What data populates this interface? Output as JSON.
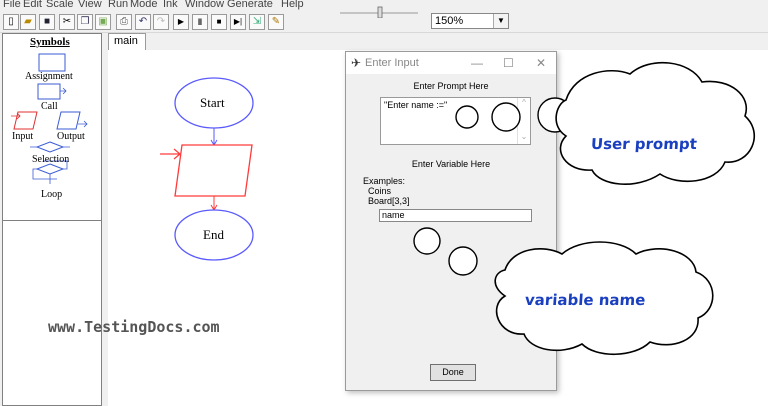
{
  "menubar": [
    "File",
    "Edit",
    "Scale",
    "View",
    "Run",
    "Mode",
    "Ink",
    "Window",
    "Generate",
    "Help"
  ],
  "toolbar": {
    "zoom_value": "150%",
    "buttons": [
      "new",
      "open",
      "save",
      "cut",
      "copy",
      "paste",
      "print",
      "undo",
      "redo",
      "run",
      "pause",
      "stop",
      "step",
      "step-into",
      "ink"
    ]
  },
  "symbols": {
    "header": "Symbols",
    "items": [
      "Assignment",
      "Call",
      "Input",
      "Output",
      "Selection",
      "Loop"
    ]
  },
  "tab": {
    "label": "main"
  },
  "flowchart": {
    "start": "Start",
    "end": "End"
  },
  "dialog": {
    "title": "Enter Input",
    "prompt_label": "Enter Prompt Here",
    "prompt_value": "\"Enter name :=\"",
    "variable_label": "Enter Variable Here",
    "examples_title": "Examples:",
    "examples": [
      "Coins",
      "Board[3,3]"
    ],
    "variable_value": "name",
    "done_label": "Done"
  },
  "callouts": {
    "user_prompt": "User prompt",
    "variable_name": "variable name"
  },
  "watermark": "www.TestingDocs.com",
  "colors": {
    "ellipse": "#5a5aff",
    "parallelogram": "#ff3a3a",
    "callout_text": "#1a3fbf"
  }
}
